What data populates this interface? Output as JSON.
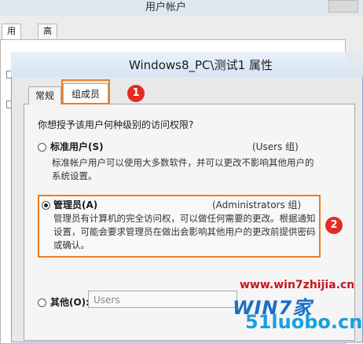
{
  "background_window": {
    "title": "用户帐户",
    "tabs": [
      "用户",
      "高级"
    ]
  },
  "dialog": {
    "title": "Windows8_PC\\测试1 属性",
    "tabs": [
      "常规",
      "组成员"
    ],
    "active_tab": "组成员",
    "question": "你想授予该用户何种级别的访问权限?",
    "options": {
      "standard": {
        "label": "标准用户(S)",
        "group": "(Users 组)",
        "description": "标准帐户用户可以使用大多数软件，并可以更改不影响其他用户的系统设置。",
        "checked": false
      },
      "admin": {
        "label": "管理员(A)",
        "group": "(Administrators 组)",
        "description": "管理员有计算机的完全访问权，可以做任何需要的更改。根据通知设置，可能会要求管理员在做出会影响其他用户的更改前提供密码或确认。",
        "checked": true
      },
      "other": {
        "label": "其他(O):",
        "select_value": "Users",
        "checked": false
      }
    }
  },
  "annotations": {
    "badge_1": "1",
    "badge_2": "2",
    "highlight_color": "#ee7d1f",
    "badge_color": "#e32b24"
  },
  "watermark": {
    "url": "www.win7zhijia.cn",
    "logo": "WIN7家",
    "site": "51luobo.cn"
  }
}
